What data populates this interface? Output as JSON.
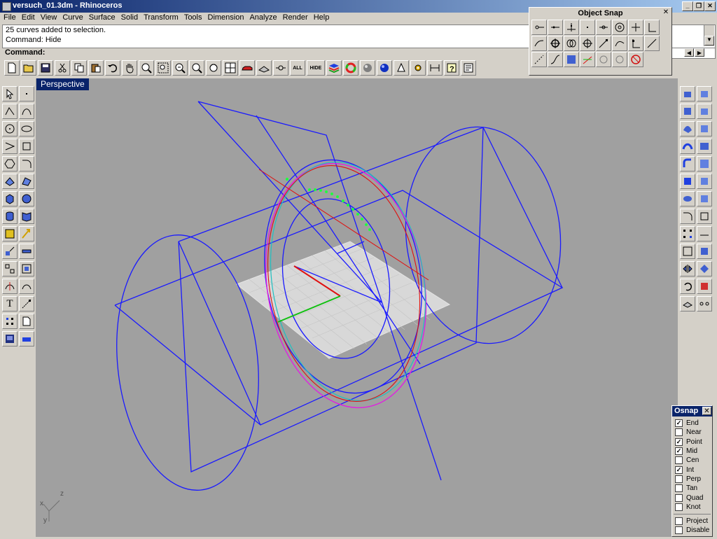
{
  "window": {
    "title": "versuch_01.3dm - Rhinoceros",
    "minimize": "_",
    "maximize": "❐",
    "close": "✕"
  },
  "menu": [
    "File",
    "Edit",
    "View",
    "Curve",
    "Surface",
    "Solid",
    "Transform",
    "Tools",
    "Dimension",
    "Analyze",
    "Render",
    "Help"
  ],
  "history": [
    "25 curves added to selection.",
    "Command: Hide"
  ],
  "command": {
    "label": "Command:"
  },
  "viewport": {
    "name": "Perspective",
    "axes": {
      "x": "x",
      "y": "y",
      "z": "z"
    }
  },
  "toolbar": {
    "all_label": "ALL",
    "hide_label": "HIDE",
    "icons": [
      "new-icon",
      "open-icon",
      "save-icon",
      "cut-icon",
      "copy-icon",
      "paste-icon",
      "undo-icon",
      "pan-hand-icon",
      "zoom-icon",
      "zoom-window-icon",
      "zoom-extents-icon",
      "zoom-selected-icon",
      "rotate-view-icon",
      "four-viewports-icon",
      "render-car-icon",
      "grid-plane-icon",
      "object-snap-icon",
      "show-all-icon",
      "hide-icon",
      "layers-icon",
      "color-wheel-icon",
      "shaded-sphere-icon",
      "rendered-sphere-icon",
      "light-icon",
      "gear-settings-icon",
      "dimension-icon",
      "help-icon",
      "properties-icon"
    ]
  },
  "object_snap_palette": {
    "title": "Object Snap",
    "close": "✕"
  },
  "osnap_panel": {
    "title": "Osnap",
    "close": "✕",
    "items": [
      {
        "label": "End",
        "checked": true
      },
      {
        "label": "Near",
        "checked": false
      },
      {
        "label": "Point",
        "checked": true
      },
      {
        "label": "Mid",
        "checked": true
      },
      {
        "label": "Cen",
        "checked": false
      },
      {
        "label": "Int",
        "checked": true
      },
      {
        "label": "Perp",
        "checked": false
      },
      {
        "label": "Tan",
        "checked": false
      },
      {
        "label": "Quad",
        "checked": false
      },
      {
        "label": "Knot",
        "checked": false
      }
    ],
    "extras": [
      {
        "label": "Project",
        "checked": false
      },
      {
        "label": "Disable",
        "checked": false
      }
    ]
  },
  "colors": {
    "wire": "#1a1aff",
    "select_red": "#e01010",
    "magenta": "#e020e0",
    "cyan": "#20c0c0",
    "green_points": "#20ff40",
    "viewport_bg": "#a0a0a0",
    "active_tab": "#0a246a"
  }
}
